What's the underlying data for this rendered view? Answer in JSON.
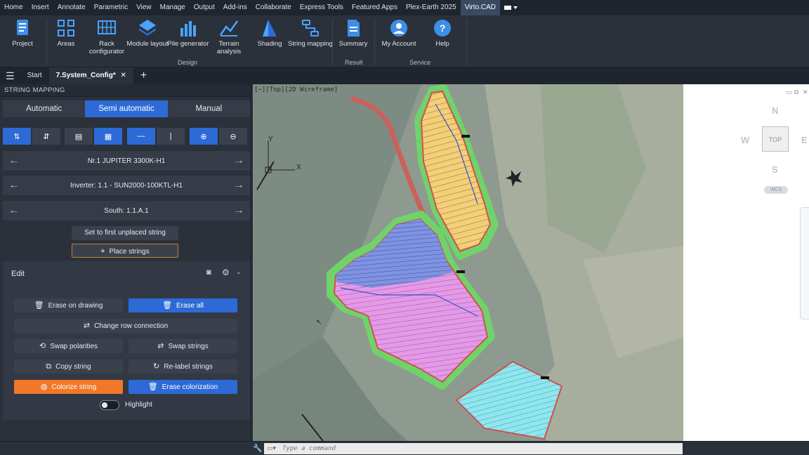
{
  "menubar": {
    "items": [
      "Home",
      "Insert",
      "Annotate",
      "Parametric",
      "View",
      "Manage",
      "Output",
      "Add-ins",
      "Collaborate",
      "Express Tools",
      "Featured Apps",
      "Plex-Earth 2025",
      "Virto.CAD"
    ],
    "active_index": 12
  },
  "ribbon": {
    "buttons": [
      {
        "label": "Project",
        "icon": "project-icon"
      },
      {
        "label": "Areas",
        "icon": "areas-icon"
      },
      {
        "label": "Rack configurator",
        "icon": "rack-configurator-icon"
      },
      {
        "label": "Module layout",
        "icon": "module-layout-icon"
      },
      {
        "label": "Pile generator",
        "icon": "pile-generator-icon"
      },
      {
        "label": "Terrain analysis",
        "icon": "terrain-analysis-icon"
      },
      {
        "label": "Shading",
        "icon": "shading-icon"
      },
      {
        "label": "String mapping",
        "icon": "string-mapping-icon"
      },
      {
        "label": "Summary",
        "icon": "summary-icon"
      },
      {
        "label": "My Account",
        "icon": "my-account-icon"
      },
      {
        "label": "Help",
        "icon": "help-icon"
      }
    ],
    "groups": {
      "design": "Design",
      "result": "Result",
      "service": "Service"
    }
  },
  "tabs": {
    "start": "Start",
    "active": "7.System_Config*"
  },
  "panel": {
    "title": "STRING MAPPING",
    "modes": [
      "Automatic",
      "Semi automatic",
      "Manual"
    ],
    "active_mode": 1,
    "navigators": {
      "module": "Nr.1 JUPITER 3300K-H1",
      "inverter": "Inverter: 1.1 - SUN2000-100KTL-H1",
      "area": "South: 1.1.A.1"
    },
    "set_first": "Set to first unplaced string",
    "place_strings": "Place strings",
    "edit": {
      "title": "Edit",
      "erase_on_drawing": "Erase on drawing",
      "erase_all": "Erase all",
      "change_row_connection": "Change row connection",
      "swap_polarities": "Swap polarities",
      "swap_strings": "Swap strings",
      "copy_string": "Copy string",
      "relabel_strings": "Re-label strings",
      "colorize_string": "Colorize string",
      "erase_colorization": "Erase colorization",
      "highlight": "Highlight"
    }
  },
  "viewport": {
    "label": "[−][Top][2D Wireframe]",
    "axis_y": "Y",
    "axis_x": "X"
  },
  "viewcube": {
    "north": "N",
    "west": "W",
    "east": "E",
    "south": "S",
    "top": "TOP",
    "wcs": "WCS"
  },
  "command": {
    "placeholder": "Type a command"
  },
  "colors": {
    "accent_blue": "#2d6ad6",
    "accent_orange": "#f07828",
    "panel_bg": "#2b313b"
  }
}
